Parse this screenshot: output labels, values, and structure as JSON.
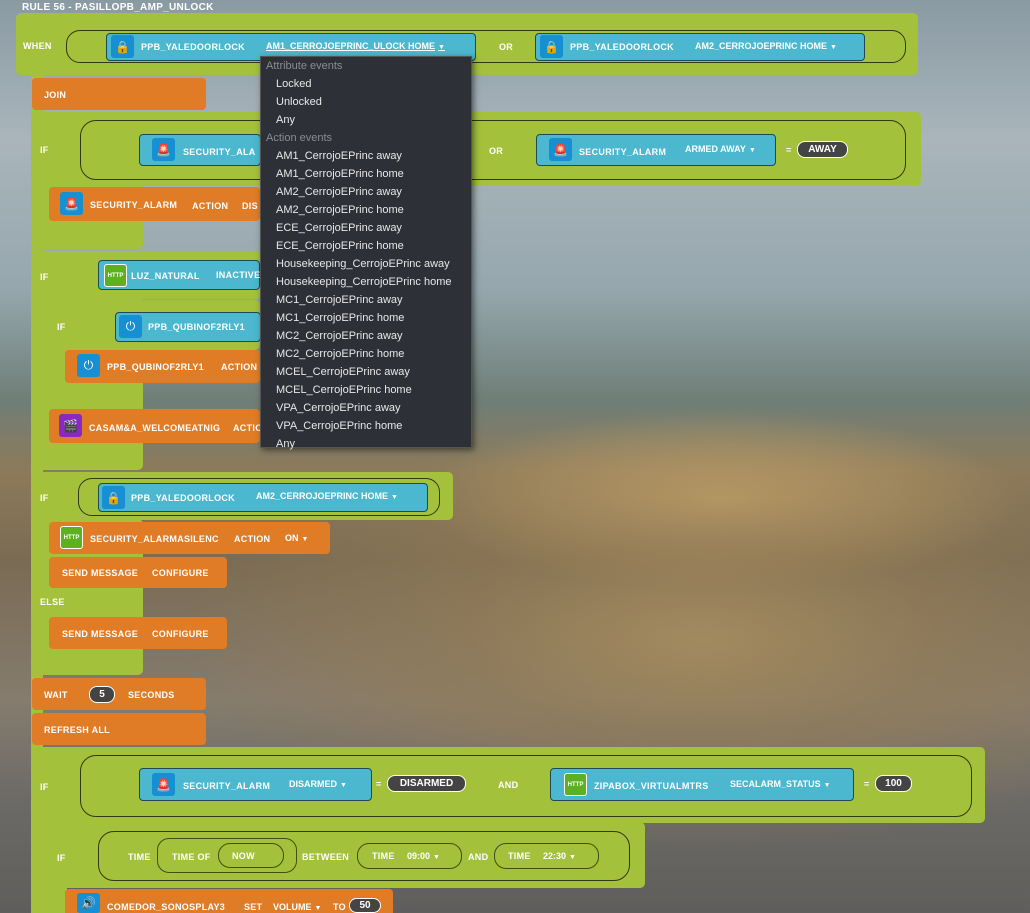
{
  "title": "RULE 56 - PASILLOPB_AMP_UNLOCK",
  "when": {
    "label": "WHEN",
    "device1": {
      "name": "PPB_YALEDOORLOCK",
      "value": "AM1_CERROJOEPRINC_ULOCK HOME"
    },
    "or_label": "OR",
    "device2": {
      "name": "PPB_YALEDOORLOCK",
      "value": "AM2_CERROJOEPRINC HOME"
    }
  },
  "dropdown": {
    "attribute_header": "Attribute events",
    "attribute_items": [
      "Locked",
      "Unlocked",
      "Any"
    ],
    "action_header": "Action events",
    "action_items": [
      "AM1_CerrojoEPrinc away",
      "AM1_CerrojoEPrinc home",
      "AM2_CerrojoEPrinc away",
      "AM2_CerrojoEPrinc home",
      "ECE_CerrojoEPrinc away",
      "ECE_CerrojoEPrinc home",
      "Housekeeping_CerrojoEPrinc away",
      "Housekeeping_CerrojoEPrinc home",
      "MC1_CerrojoEPrinc away",
      "MC1_CerrojoEPrinc home",
      "MC2_CerrojoEPrinc away",
      "MC2_CerrojoEPrinc home",
      "MCEL_CerrojoEPrinc away",
      "MCEL_CerrojoEPrinc home",
      "VPA_CerrojoEPrinc away",
      "VPA_CerrojoEPrinc home",
      "Any"
    ]
  },
  "blocks": {
    "join": "JOIN",
    "if_label": "IF",
    "else_label": "ELSE",
    "or": "OR",
    "and": "AND",
    "eq": "=",
    "if1": {
      "dev1": "SECURITY_ALA",
      "dev2": "SECURITY_ALARM",
      "dev2_value": "ARMED AWAY",
      "compare": "AWAY"
    },
    "sec_action": {
      "name": "SECURITY_ALARM",
      "action": "ACTION",
      "value": "DIS"
    },
    "if2": {
      "dev": "LUZ_NATURAL",
      "value": "INACTIVE"
    },
    "if3": {
      "dev": "PPB_QUBINOF2RLY1"
    },
    "qubino_action": {
      "name": "PPB_QUBINOF2RLY1",
      "action": "ACTION"
    },
    "casa_action": {
      "name": "CASAM&A_WELCOMEATNIG",
      "action": "ACTIO"
    },
    "if4": {
      "dev": "PPB_YALEDOORLOCK",
      "value": "AM2_CERROJOEPRINC HOME"
    },
    "silent_action": {
      "name": "SECURITY_ALARMASILENC",
      "action": "ACTION",
      "value": "ON"
    },
    "send1": {
      "label": "SEND MESSAGE",
      "configure": "CONFIGURE"
    },
    "send2": {
      "label": "SEND MESSAGE",
      "configure": "CONFIGURE"
    },
    "wait": {
      "label": "WAIT",
      "value": "5",
      "unit": "SECONDS"
    },
    "refresh": "REFRESH ALL",
    "if5": {
      "dev1": "SECURITY_ALARM",
      "dev1_value": "DISARMED",
      "compare1": "DISARMED",
      "dev2": "ZIPABOX_VIRTUALMTRS",
      "dev2_value": "SECALARM_STATUS",
      "compare2": "100"
    },
    "if6": {
      "time": "TIME",
      "time_of": "TIME OF",
      "now": "NOW",
      "between": "BETWEEN",
      "t1_label": "TIME",
      "t1": "09:00",
      "t2_label": "TIME",
      "t2": "22:30"
    },
    "sonos": {
      "name": "COMEDOR_SONOSPLAY3",
      "set": "SET",
      "param": "VOLUME",
      "to": "TO",
      "value": "50"
    }
  }
}
